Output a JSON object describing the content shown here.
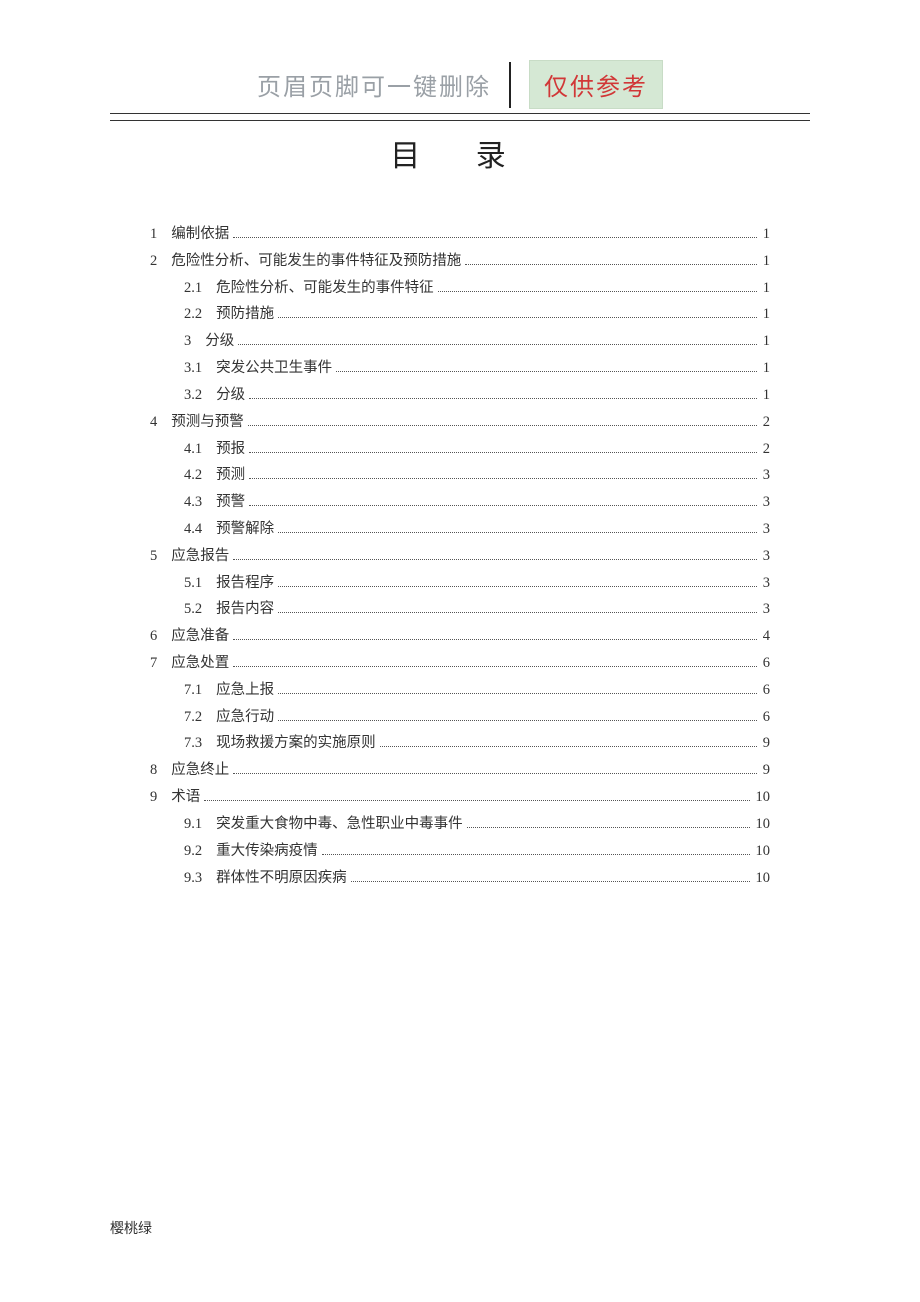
{
  "header": {
    "text": "页眉页脚可一键删除",
    "badge": "仅供参考"
  },
  "title": "目  录",
  "toc": [
    {
      "level": 0,
      "num": "1",
      "label": "编制依据",
      "page": "1"
    },
    {
      "level": 0,
      "num": "2",
      "label": "危险性分析、可能发生的事件特征及预防措施",
      "page": "1"
    },
    {
      "level": 1,
      "num": "2.1",
      "label": "危险性分析、可能发生的事件特征",
      "page": "1"
    },
    {
      "level": 1,
      "num": "2.2",
      "label": "预防措施",
      "page": "1"
    },
    {
      "level": 1,
      "num": "3",
      "label": "分级",
      "page": "1"
    },
    {
      "level": 1,
      "num": "3.1",
      "label": "突发公共卫生事件",
      "page": "1"
    },
    {
      "level": 1,
      "num": "3.2",
      "label": "分级",
      "page": "1"
    },
    {
      "level": 0,
      "num": "4",
      "label": "预测与预警",
      "page": "2"
    },
    {
      "level": 1,
      "num": "4.1",
      "label": "预报",
      "page": "2"
    },
    {
      "level": 1,
      "num": "4.2",
      "label": "预测",
      "page": "3"
    },
    {
      "level": 1,
      "num": "4.3",
      "label": "预警",
      "page": "3"
    },
    {
      "level": 1,
      "num": "4.4",
      "label": "预警解除",
      "page": "3"
    },
    {
      "level": 0,
      "num": "5",
      "label": "应急报告",
      "page": "3"
    },
    {
      "level": 1,
      "num": "5.1",
      "label": "报告程序",
      "page": "3"
    },
    {
      "level": 1,
      "num": "5.2",
      "label": "报告内容",
      "page": "3"
    },
    {
      "level": 0,
      "num": "6",
      "label": "应急准备",
      "page": "4"
    },
    {
      "level": 0,
      "num": "7",
      "label": "应急处置",
      "page": "6"
    },
    {
      "level": 1,
      "num": "7.1",
      "label": "应急上报",
      "page": "6"
    },
    {
      "level": 1,
      "num": "7.2",
      "label": "应急行动",
      "page": "6"
    },
    {
      "level": 1,
      "num": "7.3",
      "label": "现场救援方案的实施原则",
      "page": "9"
    },
    {
      "level": 0,
      "num": "8",
      "label": "应急终止",
      "page": "9"
    },
    {
      "level": 0,
      "num": "9",
      "label": "术语",
      "page": "10"
    },
    {
      "level": 1,
      "num": "9.1",
      "label": "突发重大食物中毒、急性职业中毒事件",
      "page": "10"
    },
    {
      "level": 1,
      "num": "9.2",
      "label": "重大传染病疫情",
      "page": "10"
    },
    {
      "level": 1,
      "num": "9.3",
      "label": "群体性不明原因疾病",
      "page": "10"
    }
  ],
  "footer": "樱桃绿"
}
